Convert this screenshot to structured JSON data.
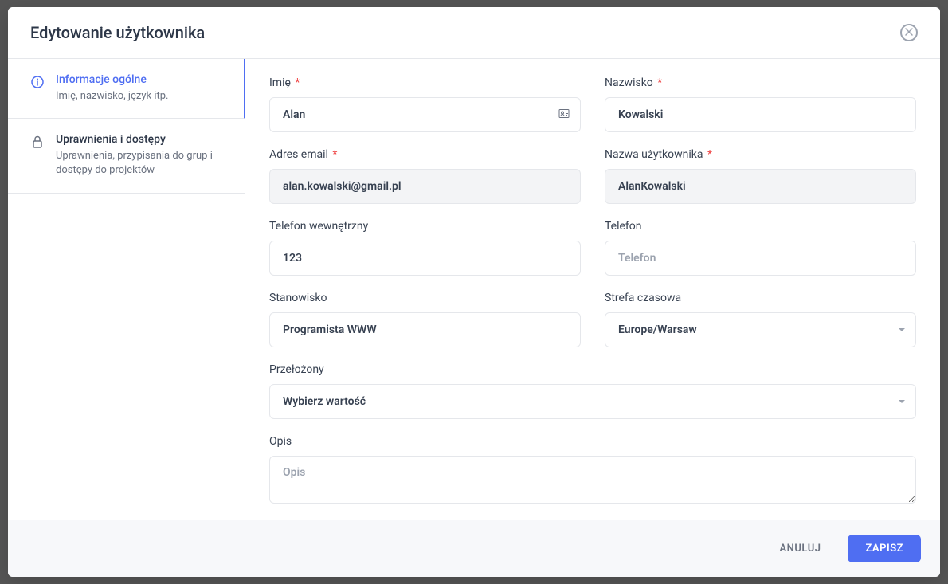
{
  "modal": {
    "title": "Edytowanie użytkownika"
  },
  "sidebar": {
    "items": [
      {
        "title": "Informacje ogólne",
        "sub": "Imię, nazwisko, język itp."
      },
      {
        "title": "Uprawnienia i dostępy",
        "sub": "Uprawnienia, przypisania do grup i dostępy do projektów"
      }
    ]
  },
  "form": {
    "firstName": {
      "label": "Imię",
      "value": "Alan",
      "required": true
    },
    "lastName": {
      "label": "Nazwisko",
      "value": "Kowalski",
      "required": true
    },
    "email": {
      "label": "Adres email",
      "value": "alan.kowalski@gmail.pl",
      "required": true
    },
    "username": {
      "label": "Nazwa użytkownika",
      "value": "AlanKowalski",
      "required": true
    },
    "internalPhone": {
      "label": "Telefon wewnętrzny",
      "value": "123"
    },
    "phone": {
      "label": "Telefon",
      "value": "",
      "placeholder": "Telefon"
    },
    "position": {
      "label": "Stanowisko",
      "value": "Programista WWW"
    },
    "timezone": {
      "label": "Strefa czasowa",
      "value": "Europe/Warsaw"
    },
    "supervisor": {
      "label": "Przełożony",
      "value": "Wybierz wartość"
    },
    "description": {
      "label": "Opis",
      "value": "",
      "placeholder": "Opis"
    }
  },
  "footer": {
    "cancel": "ANULUJ",
    "save": "ZAPISZ"
  },
  "requiredMark": "*"
}
